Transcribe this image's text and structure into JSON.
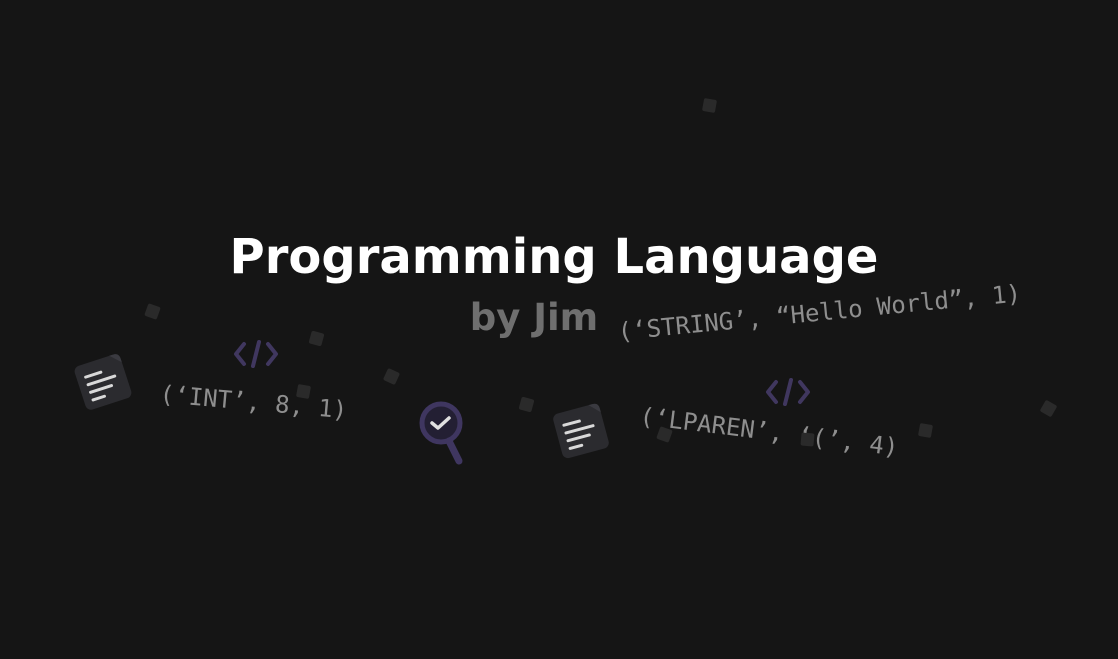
{
  "title": "Programming Language",
  "subtitle": "by Jim",
  "tokens": [
    "(‘INT’, 8, 1)",
    "(‘STRING’, “Hello World”, 1)",
    "(‘LPAREN’, ‘(’, 4)"
  ],
  "icons": [
    "code-icon",
    "code-icon",
    "document-icon",
    "document-icon",
    "magnifier-check-icon"
  ],
  "colors": {
    "background": "#151515",
    "title": "#ffffff",
    "subtitle": "#6f6f6f",
    "token_text": "#8e8e8e",
    "accent_purple": "#3f3660",
    "icon_box": "#2b2b2f"
  }
}
